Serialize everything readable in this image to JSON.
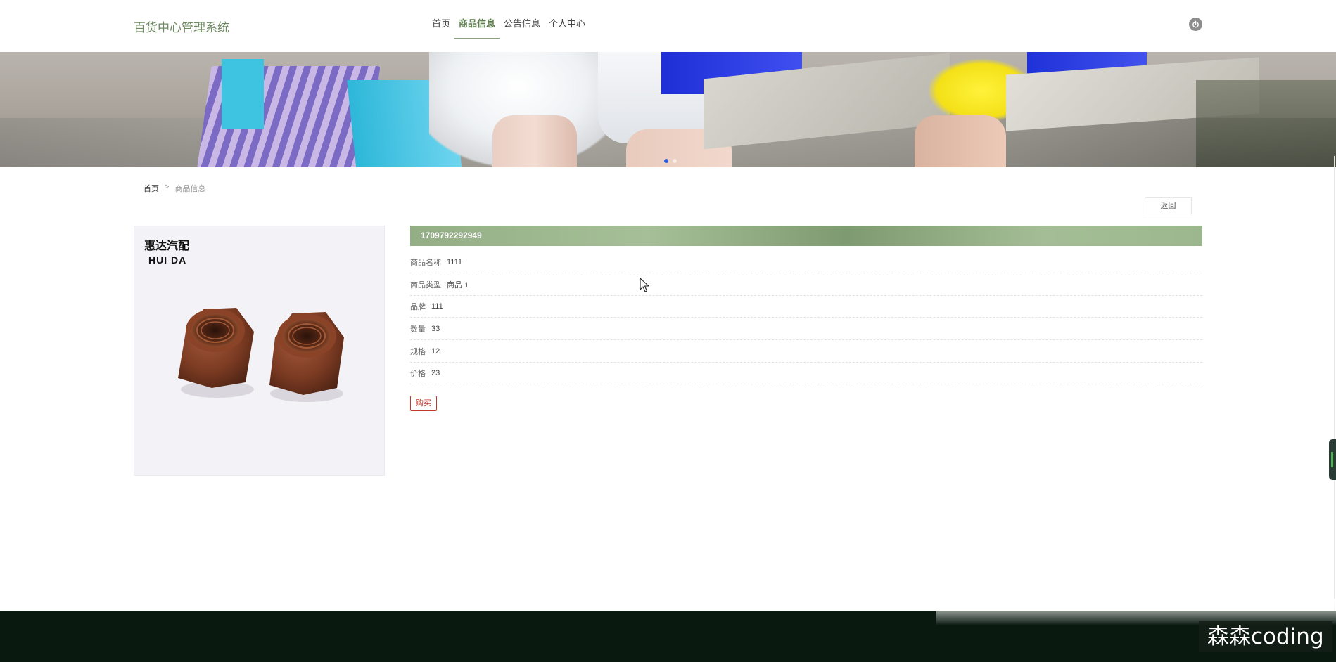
{
  "header": {
    "logo": "百货中心管理系统",
    "nav": [
      {
        "label": "首页",
        "active": false
      },
      {
        "label": "商品信息",
        "active": true
      },
      {
        "label": "公告信息",
        "active": false
      },
      {
        "label": "个人中心",
        "active": false
      }
    ],
    "power_icon": "power-icon"
  },
  "banner": {
    "slides": 2,
    "active_slide": 1
  },
  "breadcrumb": {
    "home": "首页",
    "separator": ">",
    "current": "商品信息"
  },
  "back_label": "返回",
  "product": {
    "image_brand_cn": "惠达汽配",
    "image_brand_en": "HUI DA",
    "id": "1709792292949",
    "fields": [
      {
        "label": "商品名称",
        "value": "1111"
      },
      {
        "label": "商品类型",
        "value": "商品 1"
      },
      {
        "label": "品牌",
        "value": "111"
      },
      {
        "label": "数量",
        "value": "33"
      },
      {
        "label": "规格",
        "value": "12"
      },
      {
        "label": "价格",
        "value": "23"
      }
    ],
    "buy_label": "购买"
  },
  "watermark": "森森coding",
  "colors": {
    "accent": "#8aa57c",
    "buy": "#c0392b",
    "footer": "#091910"
  }
}
